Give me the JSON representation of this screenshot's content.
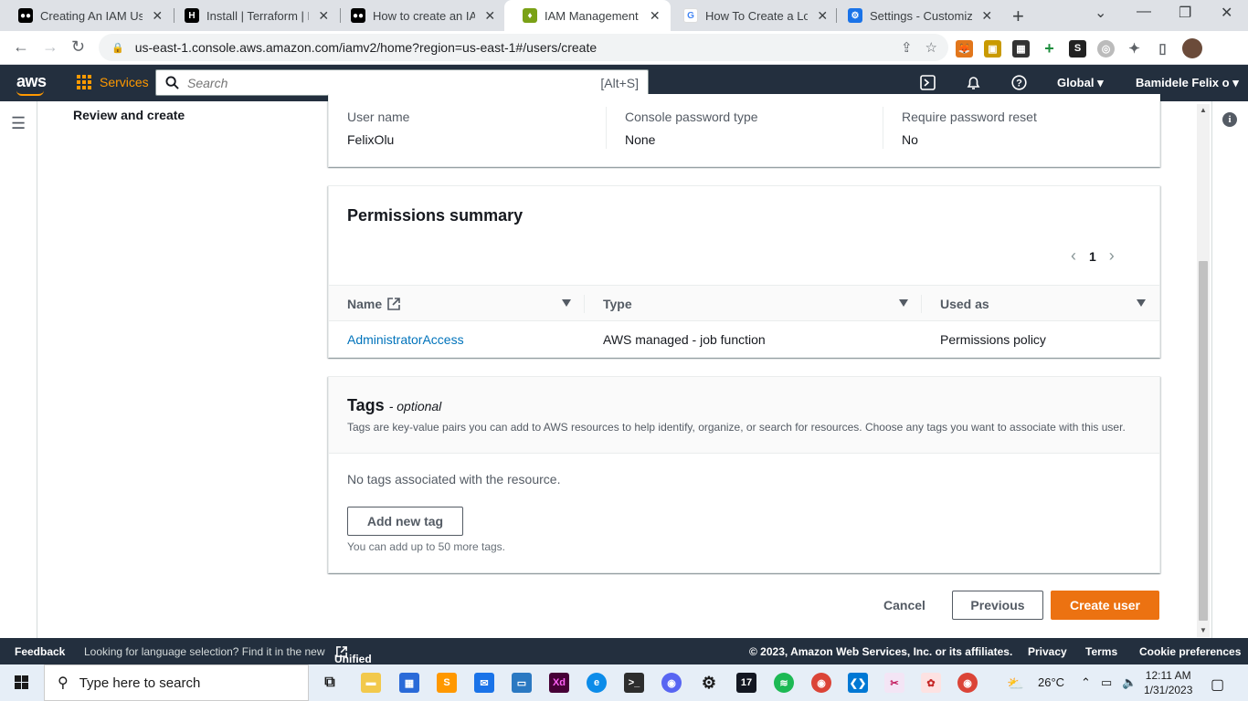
{
  "browser": {
    "tabs": [
      {
        "title": "Creating An IAM User",
        "favicon": "medium-icon",
        "color": "#000000"
      },
      {
        "title": "Install | Terraform | HashiCorp",
        "favicon": "hashicorp-icon",
        "color": "#000000"
      },
      {
        "title": "How to create an IAM",
        "favicon": "medium-icon",
        "color": "#000000"
      },
      {
        "title": "IAM Management Console",
        "favicon": "aws-iam-icon",
        "color": "#7aa116",
        "active": true
      },
      {
        "title": "How To Create a Load",
        "favicon": "google-icon",
        "color": "#4285f4"
      },
      {
        "title": "Settings - Customize profile",
        "favicon": "gear-icon",
        "color": "#1a73e8"
      }
    ],
    "url": "us-east-1.console.aws.amazon.com/iamv2/home?region=us-east-1#/users/create"
  },
  "aws_nav": {
    "logo": "aws",
    "services_label": "Services",
    "search_placeholder": "Search",
    "search_shortcut": "[Alt+S]",
    "region": "Global",
    "account": "Bamidele Felix o"
  },
  "sidebar": {
    "step_label": "Review and create"
  },
  "user_details": {
    "fields": [
      {
        "label": "User name",
        "value": "FelixOlu"
      },
      {
        "label": "Console password type",
        "value": "None"
      },
      {
        "label": "Require password reset",
        "value": "No"
      }
    ]
  },
  "permissions": {
    "title": "Permissions summary",
    "page": "1",
    "columns": [
      "Name",
      "Type",
      "Used as"
    ],
    "rows": [
      {
        "name": "AdministratorAccess",
        "type": "AWS managed - job function",
        "used_as": "Permissions policy"
      }
    ]
  },
  "tags": {
    "title": "Tags",
    "optional": "- optional",
    "description": "Tags are key-value pairs you can add to AWS resources to help identify, organize, or search for resources. Choose any tags you want to associate with this user.",
    "empty": "No tags associated with the resource.",
    "add_button": "Add new tag",
    "limit": "You can add up to 50 more tags."
  },
  "actions": {
    "cancel": "Cancel",
    "previous": "Previous",
    "create": "Create user"
  },
  "footer": {
    "feedback": "Feedback",
    "lang_prompt": "Looking for language selection? Find it in the new",
    "unified": "Unified Settings",
    "copyright": "© 2023, Amazon Web Services, Inc. or its affiliates.",
    "privacy": "Privacy",
    "terms": "Terms",
    "cookies": "Cookie preferences"
  },
  "taskbar": {
    "search_placeholder": "Type here to search",
    "weather": "26°C",
    "time": "12:11 AM",
    "date": "1/31/2023"
  },
  "colors": {
    "aws_nav": "#232f3e",
    "aws_orange": "#ff9900",
    "primary_button": "#ec7211",
    "link": "#0073bb"
  }
}
